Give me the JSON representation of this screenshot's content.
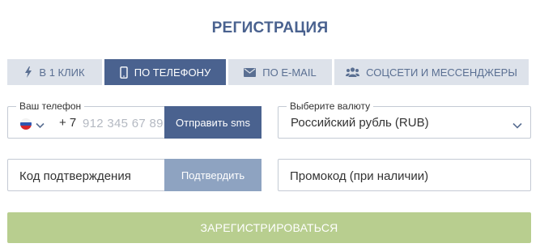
{
  "title": "РЕГИСТРАЦИЯ",
  "tabs": [
    {
      "label": "В 1 КЛИК",
      "icon": "lightning-icon",
      "active": false
    },
    {
      "label": "ПО ТЕЛЕФОНУ",
      "icon": "phone-icon",
      "active": true
    },
    {
      "label": "ПО E-MAIL",
      "icon": "envelope-icon",
      "active": false
    },
    {
      "label": "СОЦСЕТИ И МЕССЕНДЖЕРЫ",
      "icon": "users-icon",
      "active": false
    }
  ],
  "phone": {
    "legend": "Ваш телефон",
    "country_icon": "russia-flag-icon",
    "code": "+ 7",
    "placeholder": "912 345 67 89",
    "send_sms_label": "Отправить sms"
  },
  "currency": {
    "legend": "Выберите валюту",
    "selected": "Российский рубль (RUB)"
  },
  "confirmation": {
    "placeholder": "Код подтверждения",
    "confirm_label": "Подтвердить"
  },
  "promo": {
    "placeholder": "Промокод (при наличии)"
  },
  "register_label": "ЗАРЕГИСТРИРОВАТЬСЯ",
  "colors": {
    "accent": "#4a628f",
    "tab_inactive": "#dde2ea",
    "confirm_disabled": "#8ea3c1",
    "register_disabled": "#b8ce8f"
  }
}
